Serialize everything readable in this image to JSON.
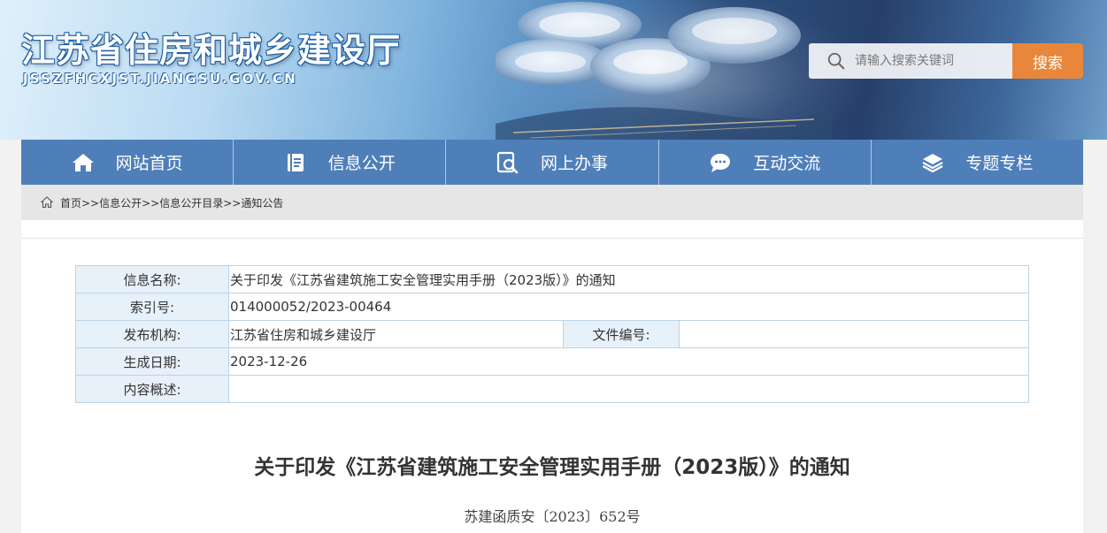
{
  "header": {
    "site_title": "江苏省住房和城乡建设厅",
    "site_domain": "JSSZFHCXJST.JIANGSU.GOV.CN",
    "search_placeholder": "请输入搜索关键词",
    "search_button": "搜索"
  },
  "nav": {
    "items": [
      {
        "label": "网站首页",
        "icon": "home-icon"
      },
      {
        "label": "信息公开",
        "icon": "document-icon"
      },
      {
        "label": "网上办事",
        "icon": "search-doc-icon"
      },
      {
        "label": "互动交流",
        "icon": "chat-icon"
      },
      {
        "label": "专题专栏",
        "icon": "layers-icon"
      }
    ]
  },
  "breadcrumb": {
    "icon": "home-icon",
    "text": "首页>>信息公开>>信息公开目录>>通知公告"
  },
  "meta": {
    "info_name_label": "信息名称:",
    "info_name_value": "关于印发《江苏省建筑施工安全管理实用手册（2023版）》的通知",
    "index_label": "索引号:",
    "index_value": "014000052/2023-00464",
    "publisher_label": "发布机构:",
    "publisher_value": "江苏省住房和城乡建设厅",
    "doc_number_label": "文件编号:",
    "doc_number_value": "",
    "date_label": "生成日期:",
    "date_value": "2023-12-26",
    "summary_label": "内容概述:",
    "summary_value": ""
  },
  "article": {
    "title": "关于印发《江苏省建筑施工安全管理实用手册（2023版）》的通知",
    "doc_no": "苏建函质安〔2023〕652号"
  },
  "colors": {
    "nav_bg": "#4f7fb9",
    "search_button": "#e8873c",
    "table_label_bg": "#e7f1fa"
  }
}
